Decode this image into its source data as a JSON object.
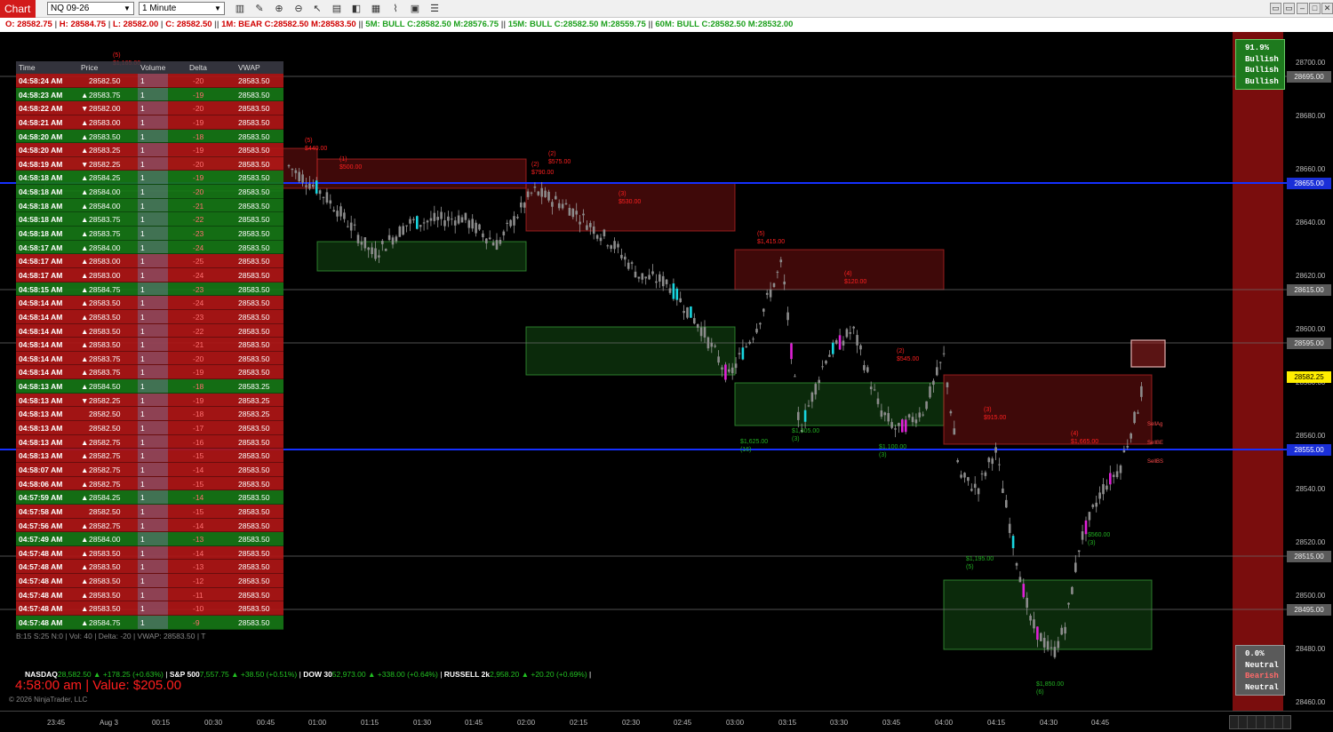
{
  "toolbar": {
    "tab_label": "Chart",
    "instrument": "NQ 09-26",
    "interval": "1 Minute"
  },
  "status": {
    "open": "O: 28582.75",
    "high": "H: 28584.75",
    "low": "L: 28582.00",
    "close": "C: 28582.50",
    "tf1": "1M: BEAR C:28582.50 M:28583.50",
    "tf5": "5M: BULL C:28582.50 M:28576.75",
    "tf15": "15M: BULL C:28582.50 M:28559.75",
    "tf60": "60M: BULL C:28582.50 M:28532.00"
  },
  "time_sales": {
    "headers": [
      "Time",
      "Price",
      "Volume",
      "Delta",
      "VWAP"
    ],
    "rows": [
      {
        "time": "04:58:24 AM",
        "price": "28582.50",
        "dir": "",
        "vol": "1",
        "delta": "-20",
        "vwap": "28583.50",
        "color": "red"
      },
      {
        "time": "04:58:23 AM",
        "price": "28583.75",
        "dir": "▲",
        "vol": "1",
        "delta": "-19",
        "vwap": "28583.50",
        "color": "green"
      },
      {
        "time": "04:58:22 AM",
        "price": "28582.00",
        "dir": "▼",
        "vol": "1",
        "delta": "-20",
        "vwap": "28583.50",
        "color": "red"
      },
      {
        "time": "04:58:21 AM",
        "price": "28583.00",
        "dir": "▲",
        "vol": "1",
        "delta": "-19",
        "vwap": "28583.50",
        "color": "red"
      },
      {
        "time": "04:58:20 AM",
        "price": "28583.50",
        "dir": "▲",
        "vol": "1",
        "delta": "-18",
        "vwap": "28583.50",
        "color": "green"
      },
      {
        "time": "04:58:20 AM",
        "price": "28583.25",
        "dir": "▲",
        "vol": "1",
        "delta": "-19",
        "vwap": "28583.50",
        "color": "red"
      },
      {
        "time": "04:58:19 AM",
        "price": "28582.25",
        "dir": "▼",
        "vol": "1",
        "delta": "-20",
        "vwap": "28583.50",
        "color": "red"
      },
      {
        "time": "04:58:18 AM",
        "price": "28584.25",
        "dir": "▲",
        "vol": "1",
        "delta": "-19",
        "vwap": "28583.50",
        "color": "green"
      },
      {
        "time": "04:58:18 AM",
        "price": "28584.00",
        "dir": "▲",
        "vol": "1",
        "delta": "-20",
        "vwap": "28583.50",
        "color": "green"
      },
      {
        "time": "04:58:18 AM",
        "price": "28584.00",
        "dir": "▲",
        "vol": "1",
        "delta": "-21",
        "vwap": "28583.50",
        "color": "green"
      },
      {
        "time": "04:58:18 AM",
        "price": "28583.75",
        "dir": "▲",
        "vol": "1",
        "delta": "-22",
        "vwap": "28583.50",
        "color": "green"
      },
      {
        "time": "04:58:18 AM",
        "price": "28583.75",
        "dir": "▲",
        "vol": "1",
        "delta": "-23",
        "vwap": "28583.50",
        "color": "green"
      },
      {
        "time": "04:58:17 AM",
        "price": "28584.00",
        "dir": "▲",
        "vol": "1",
        "delta": "-24",
        "vwap": "28583.50",
        "color": "green"
      },
      {
        "time": "04:58:17 AM",
        "price": "28583.00",
        "dir": "▲",
        "vol": "1",
        "delta": "-25",
        "vwap": "28583.50",
        "color": "red"
      },
      {
        "time": "04:58:17 AM",
        "price": "28583.00",
        "dir": "▲",
        "vol": "1",
        "delta": "-24",
        "vwap": "28583.50",
        "color": "red"
      },
      {
        "time": "04:58:15 AM",
        "price": "28584.75",
        "dir": "▲",
        "vol": "1",
        "delta": "-23",
        "vwap": "28583.50",
        "color": "green"
      },
      {
        "time": "04:58:14 AM",
        "price": "28583.50",
        "dir": "▲",
        "vol": "1",
        "delta": "-24",
        "vwap": "28583.50",
        "color": "red"
      },
      {
        "time": "04:58:14 AM",
        "price": "28583.50",
        "dir": "▲",
        "vol": "1",
        "delta": "-23",
        "vwap": "28583.50",
        "color": "red"
      },
      {
        "time": "04:58:14 AM",
        "price": "28583.50",
        "dir": "▲",
        "vol": "1",
        "delta": "-22",
        "vwap": "28583.50",
        "color": "red"
      },
      {
        "time": "04:58:14 AM",
        "price": "28583.50",
        "dir": "▲",
        "vol": "1",
        "delta": "-21",
        "vwap": "28583.50",
        "color": "red"
      },
      {
        "time": "04:58:14 AM",
        "price": "28583.75",
        "dir": "▲",
        "vol": "1",
        "delta": "-20",
        "vwap": "28583.50",
        "color": "red"
      },
      {
        "time": "04:58:14 AM",
        "price": "28583.75",
        "dir": "▲",
        "vol": "1",
        "delta": "-19",
        "vwap": "28583.50",
        "color": "red"
      },
      {
        "time": "04:58:13 AM",
        "price": "28584.50",
        "dir": "▲",
        "vol": "1",
        "delta": "-18",
        "vwap": "28583.25",
        "color": "green"
      },
      {
        "time": "04:58:13 AM",
        "price": "28582.25",
        "dir": "▼",
        "vol": "1",
        "delta": "-19",
        "vwap": "28583.25",
        "color": "red"
      },
      {
        "time": "04:58:13 AM",
        "price": "28582.50",
        "dir": "",
        "vol": "1",
        "delta": "-18",
        "vwap": "28583.25",
        "color": "red"
      },
      {
        "time": "04:58:13 AM",
        "price": "28582.50",
        "dir": "",
        "vol": "1",
        "delta": "-17",
        "vwap": "28583.50",
        "color": "red"
      },
      {
        "time": "04:58:13 AM",
        "price": "28582.75",
        "dir": "▲",
        "vol": "1",
        "delta": "-16",
        "vwap": "28583.50",
        "color": "red"
      },
      {
        "time": "04:58:13 AM",
        "price": "28582.75",
        "dir": "▲",
        "vol": "1",
        "delta": "-15",
        "vwap": "28583.50",
        "color": "red"
      },
      {
        "time": "04:58:07 AM",
        "price": "28582.75",
        "dir": "▲",
        "vol": "1",
        "delta": "-14",
        "vwap": "28583.50",
        "color": "red"
      },
      {
        "time": "04:58:06 AM",
        "price": "28582.75",
        "dir": "▲",
        "vol": "1",
        "delta": "-15",
        "vwap": "28583.50",
        "color": "red"
      },
      {
        "time": "04:57:59 AM",
        "price": "28584.25",
        "dir": "▲",
        "vol": "1",
        "delta": "-14",
        "vwap": "28583.50",
        "color": "green"
      },
      {
        "time": "04:57:58 AM",
        "price": "28582.50",
        "dir": "",
        "vol": "1",
        "delta": "-15",
        "vwap": "28583.50",
        "color": "red"
      },
      {
        "time": "04:57:56 AM",
        "price": "28582.75",
        "dir": "▲",
        "vol": "1",
        "delta": "-14",
        "vwap": "28583.50",
        "color": "red"
      },
      {
        "time": "04:57:49 AM",
        "price": "28584.00",
        "dir": "▲",
        "vol": "1",
        "delta": "-13",
        "vwap": "28583.50",
        "color": "green"
      },
      {
        "time": "04:57:48 AM",
        "price": "28583.50",
        "dir": "▲",
        "vol": "1",
        "delta": "-14",
        "vwap": "28583.50",
        "color": "red"
      },
      {
        "time": "04:57:48 AM",
        "price": "28583.50",
        "dir": "▲",
        "vol": "1",
        "delta": "-13",
        "vwap": "28583.50",
        "color": "red"
      },
      {
        "time": "04:57:48 AM",
        "price": "28583.50",
        "dir": "▲",
        "vol": "1",
        "delta": "-12",
        "vwap": "28583.50",
        "color": "red"
      },
      {
        "time": "04:57:48 AM",
        "price": "28583.50",
        "dir": "▲",
        "vol": "1",
        "delta": "-11",
        "vwap": "28583.50",
        "color": "red"
      },
      {
        "time": "04:57:48 AM",
        "price": "28583.50",
        "dir": "▲",
        "vol": "1",
        "delta": "-10",
        "vwap": "28583.50",
        "color": "red"
      },
      {
        "time": "04:57:48 AM",
        "price": "28584.75",
        "dir": "▲",
        "vol": "1",
        "delta": "-9",
        "vwap": "28583.50",
        "color": "green"
      }
    ],
    "footer": "B:15 S:25 N:0 | Vol: 40 | Delta: -20 | VWAP: 28583.50 | T"
  },
  "sentiment_top": {
    "pct": "91.9%",
    "l1": "Bullish",
    "l2": "Bullish",
    "l3": "Bullish"
  },
  "sentiment_bottom": {
    "pct": "0.0%",
    "l1": "Neutral",
    "l2": "Bearish",
    "l3": "Neutral"
  },
  "markets": {
    "nasdaq_name": "NASDAQ",
    "nasdaq_val": "28,582.50",
    "nasdaq_chg": "▲ +178.25 (+0.63%)",
    "sp_name": "S&P 500",
    "sp_val": "7,557.75",
    "sp_chg": "▲ +38.50 (+0.51%)",
    "dow_name": "DOW 30",
    "dow_val": "52,973.00",
    "dow_chg": "▲ +338.00 (+0.64%)",
    "rus_name": "RUSSELL 2k",
    "rus_val": "2,958.20",
    "rus_chg": "▲ +20.20 (+0.69%)"
  },
  "clock_readout": "4:58:00 am | Value: $205.00",
  "copyright": "© 2026 NinjaTrader, LLC",
  "price_axis": {
    "ticks": [
      "28700.00",
      "28680.00",
      "28660.00",
      "28640.00",
      "28620.00",
      "28600.00",
      "28580.00",
      "28560.00",
      "28540.00",
      "28520.00",
      "28500.00",
      "28480.00",
      "28460.00"
    ],
    "tags": [
      {
        "label": "28695.00",
        "price": 28695,
        "style": "gray"
      },
      {
        "label": "28655.00",
        "price": 28655,
        "style": "blue"
      },
      {
        "label": "28615.00",
        "price": 28615,
        "style": "gray"
      },
      {
        "label": "28595.00",
        "price": 28595,
        "style": "gray"
      },
      {
        "label": "28582.25",
        "price": 28582.25,
        "style": "yellow"
      },
      {
        "label": "28555.00",
        "price": 28555,
        "style": "blue"
      },
      {
        "label": "28515.00",
        "price": 28515,
        "style": "gray"
      },
      {
        "label": "28495.00",
        "price": 28495,
        "style": "gray"
      }
    ]
  },
  "time_axis": {
    "labels": [
      "23:45",
      "Aug 3",
      "00:15",
      "00:30",
      "00:45",
      "01:00",
      "01:15",
      "01:30",
      "01:45",
      "02:00",
      "02:15",
      "02:30",
      "02:45",
      "03:00",
      "03:15",
      "03:30",
      "03:45",
      "04:00",
      "04:15",
      "04:30",
      "04:45"
    ]
  },
  "chart_data": {
    "type": "candlestick",
    "symbol": "NQ 09-26",
    "interval": "1 Minute",
    "ylim": [
      28455,
      28710
    ],
    "horizontal_levels": [
      28695,
      28655,
      28615,
      28595,
      28555,
      28515,
      28495
    ],
    "supply_zones": [
      {
        "from": "00:45",
        "to": "01:00",
        "low": 28653,
        "high": 28668
      },
      {
        "from": "01:00",
        "to": "02:00",
        "low": 28653,
        "high": 28664
      },
      {
        "from": "02:00",
        "to": "03:00",
        "low": 28637,
        "high": 28655
      },
      {
        "from": "03:00",
        "to": "04:00",
        "low": 28615,
        "high": 28630
      },
      {
        "from": "04:00",
        "to": "04:55",
        "low": 28557,
        "high": 28583
      }
    ],
    "demand_zones": [
      {
        "from": "23:40",
        "to": "00:50",
        "low": 28652,
        "high": 28665
      },
      {
        "from": "01:00",
        "to": "02:00",
        "low": 28622,
        "high": 28633
      },
      {
        "from": "02:00",
        "to": "03:00",
        "low": 28583,
        "high": 28601
      },
      {
        "from": "03:00",
        "to": "04:00",
        "low": 28564,
        "high": 28580
      },
      {
        "from": "04:00",
        "to": "04:55",
        "low": 28480,
        "high": 28506
      }
    ],
    "labels": [
      {
        "text": "(5)",
        "time": "00:05",
        "price": 28704,
        "color": "red"
      },
      {
        "text": "$1,165.00",
        "time": "00:05",
        "price": 28701,
        "color": "red"
      },
      {
        "text": "(5)",
        "time": "01:00",
        "price": 28672,
        "color": "red"
      },
      {
        "text": "$440.00",
        "time": "01:00",
        "price": 28669,
        "color": "red"
      },
      {
        "text": "(1)",
        "time": "01:10",
        "price": 28665,
        "color": "red"
      },
      {
        "text": "$500.00",
        "time": "01:10",
        "price": 28662,
        "color": "red"
      },
      {
        "text": "(2)",
        "time": "02:05",
        "price": 28663,
        "color": "red"
      },
      {
        "text": "$790.00",
        "time": "02:05",
        "price": 28660,
        "color": "red"
      },
      {
        "text": "(2)",
        "time": "02:10",
        "price": 28667,
        "color": "red"
      },
      {
        "text": "$575.00",
        "time": "02:10",
        "price": 28664,
        "color": "red"
      },
      {
        "text": "(3)",
        "time": "02:30",
        "price": 28652,
        "color": "red"
      },
      {
        "text": "$530.00",
        "time": "02:30",
        "price": 28649,
        "color": "red"
      },
      {
        "text": "(5)",
        "time": "03:10",
        "price": 28637,
        "color": "red"
      },
      {
        "text": "$1,415.00",
        "time": "03:10",
        "price": 28634,
        "color": "red"
      },
      {
        "text": "(4)",
        "time": "03:35",
        "price": 28622,
        "color": "red"
      },
      {
        "text": "$120.00",
        "time": "03:35",
        "price": 28619,
        "color": "red"
      },
      {
        "text": "(2)",
        "time": "03:50",
        "price": 28593,
        "color": "red"
      },
      {
        "text": "$545.00",
        "time": "03:50",
        "price": 28590,
        "color": "red"
      },
      {
        "text": "(3)",
        "time": "04:15",
        "price": 28571,
        "color": "red"
      },
      {
        "text": "$915.00",
        "time": "04:15",
        "price": 28568,
        "color": "red"
      },
      {
        "text": "(4)",
        "time": "04:40",
        "price": 28562,
        "color": "red"
      },
      {
        "text": "$1,665.00",
        "time": "04:40",
        "price": 28559,
        "color": "red"
      },
      {
        "text": "$1,625.00",
        "time": "03:05",
        "price": 28559,
        "color": "green"
      },
      {
        "text": "(16)",
        "time": "03:05",
        "price": 28556,
        "color": "green"
      },
      {
        "text": "$1,305.00",
        "time": "03:20",
        "price": 28563,
        "color": "green"
      },
      {
        "text": "(3)",
        "time": "03:20",
        "price": 28560,
        "color": "green"
      },
      {
        "text": "$1,100.00",
        "time": "03:45",
        "price": 28557,
        "color": "green"
      },
      {
        "text": "(3)",
        "time": "03:45",
        "price": 28554,
        "color": "green"
      },
      {
        "text": "$1,195.00",
        "time": "04:10",
        "price": 28515,
        "color": "green"
      },
      {
        "text": "(5)",
        "time": "04:10",
        "price": 28512,
        "color": "green"
      },
      {
        "text": "$560.00",
        "time": "04:45",
        "price": 28524,
        "color": "green"
      },
      {
        "text": "(3)",
        "time": "04:45",
        "price": 28521,
        "color": "green"
      },
      {
        "text": "$1,850.00",
        "time": "04:30",
        "price": 28468,
        "color": "green"
      },
      {
        "text": "(6)",
        "time": "04:30",
        "price": 28465,
        "color": "green"
      }
    ]
  }
}
